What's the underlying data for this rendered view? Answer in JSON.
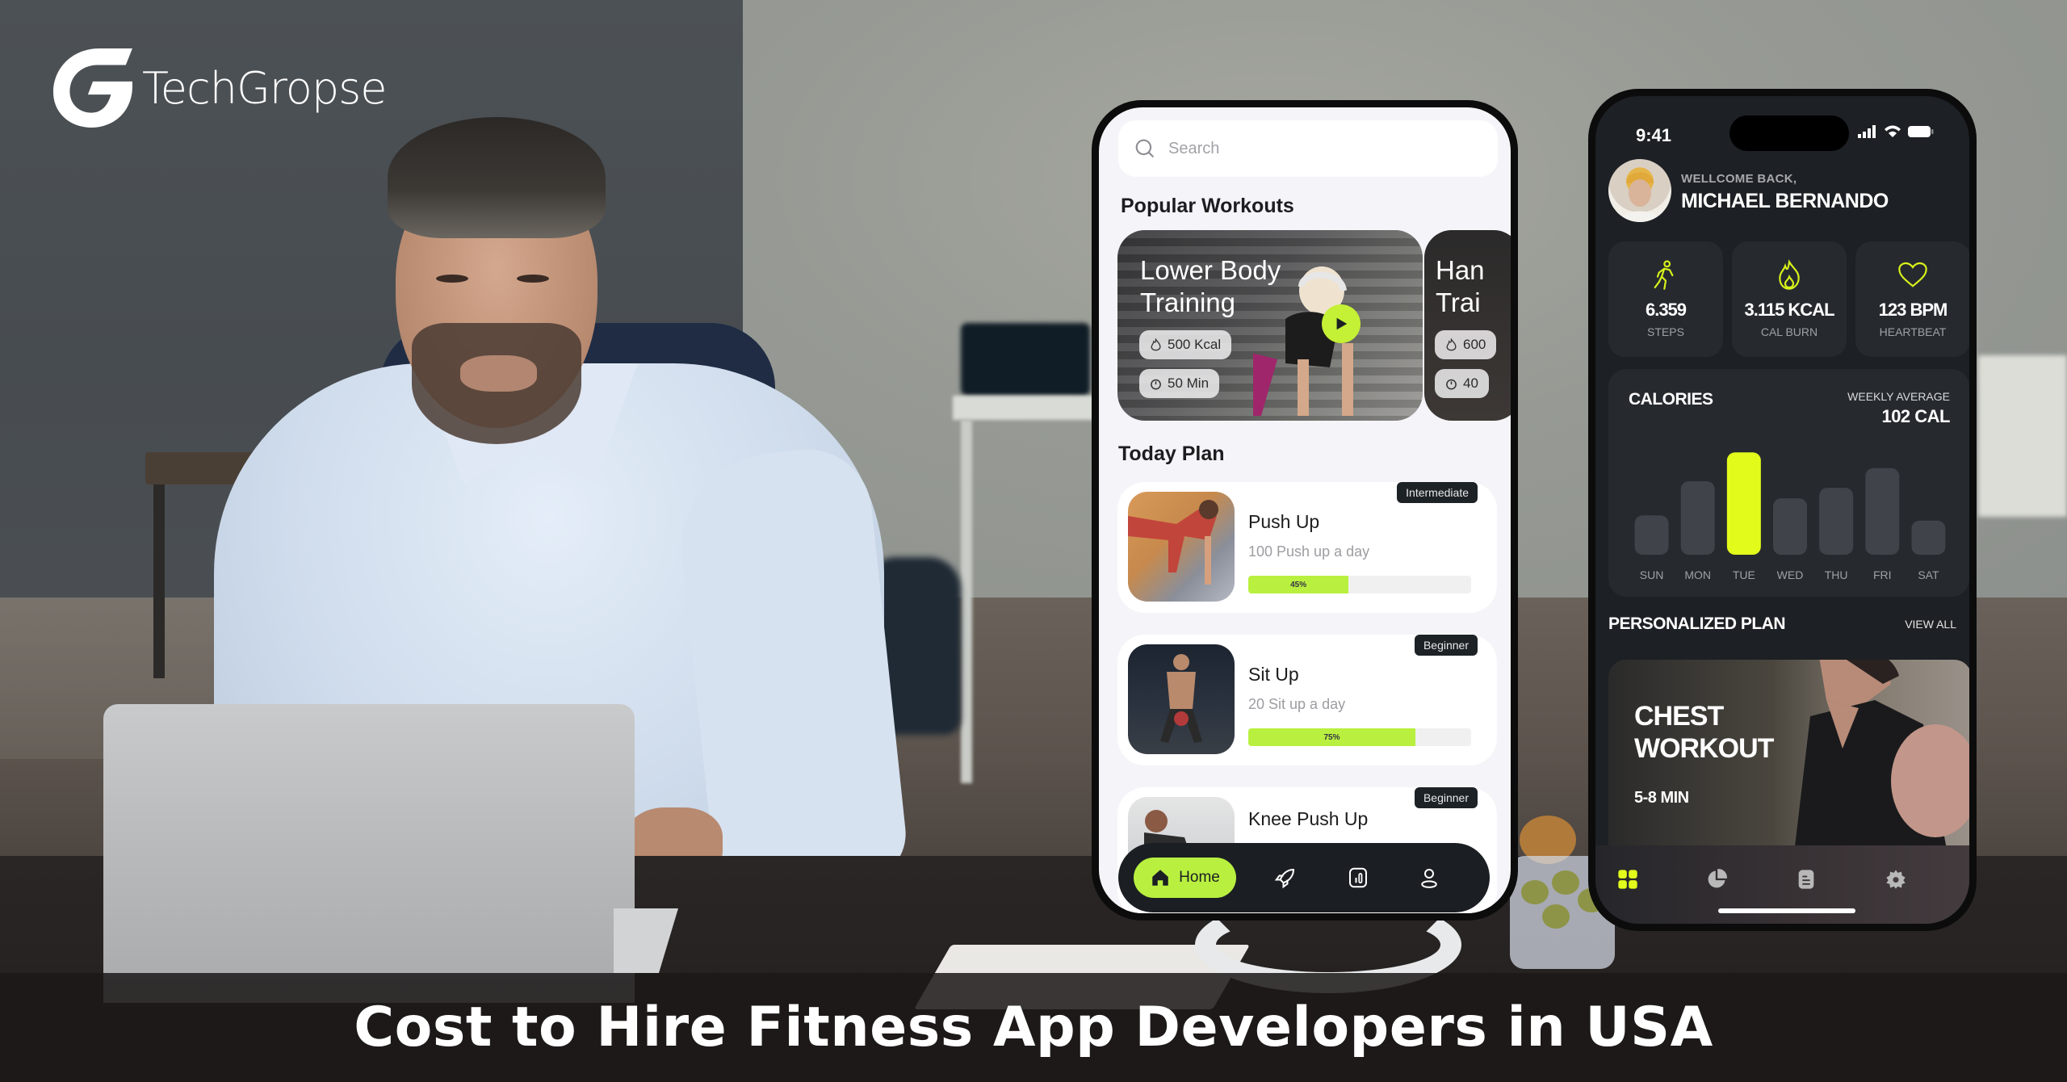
{
  "brand": {
    "name": "TechGropse",
    "logo_icon": "g-leaf-logo"
  },
  "headline": "Cost to Hire Fitness App Developers in USA",
  "left_phone": {
    "search": {
      "placeholder": "Search",
      "icon": "search-icon"
    },
    "popular_title": "Popular Workouts",
    "workouts": [
      {
        "title_line1": "Lower Body",
        "title_line2": "Training",
        "kcal": "500 Kcal",
        "duration": "50 Min"
      },
      {
        "title_line1": "Han",
        "title_line2": "Trai",
        "kcal": "600",
        "duration": "40"
      }
    ],
    "today_title": "Today Plan",
    "plans": [
      {
        "name": "Push Up",
        "sub": "100 Push up a day",
        "level": "Intermediate",
        "progress": 45,
        "progress_label": "45%"
      },
      {
        "name": "Sit Up",
        "sub": "20 Sit up a day",
        "level": "Beginner",
        "progress": 75,
        "progress_label": "75%"
      },
      {
        "name": "Knee Push Up",
        "sub": "",
        "level": "Beginner"
      }
    ],
    "nav": {
      "home_label": "Home",
      "icons": [
        "home-icon",
        "rocket-icon",
        "stats-icon",
        "profile-icon"
      ]
    },
    "accent": "#b9f040"
  },
  "right_phone": {
    "status": {
      "time": "9:41"
    },
    "welcome": "WELLCOME BACK,",
    "user_name": "MICHAEL BERNANDO",
    "stats": [
      {
        "icon": "walking-icon",
        "value": "6.359",
        "label": "STEPS"
      },
      {
        "icon": "flame-icon",
        "value": "3.115 KCAL",
        "label": "CAL BURN"
      },
      {
        "icon": "heart-icon",
        "value": "123 BPM",
        "label": "HEARTBEAT"
      }
    ],
    "calories": {
      "title": "CALORIES",
      "avg_label": "WEEKLY AVERAGE",
      "avg_value": "102 CAL"
    },
    "plan_title": "PERSONALIZED PLAN",
    "view_all": "VIEW ALL",
    "plan_card": {
      "line1": "CHEST",
      "line2": "WORKOUT",
      "duration": "5-8 MIN"
    },
    "tabs": [
      "grid-icon",
      "pie-chart-icon",
      "document-icon",
      "settings-icon"
    ],
    "accent": "#e2fb1b"
  },
  "chart_data": {
    "type": "bar",
    "title": "CALORIES",
    "categories": [
      "SUN",
      "MON",
      "TUE",
      "WED",
      "THU",
      "FRI",
      "SAT"
    ],
    "values": [
      30,
      56,
      78,
      43,
      51,
      66,
      26
    ],
    "highlight": "TUE",
    "ylim": [
      0,
      80
    ],
    "xlabel": "",
    "ylabel": "",
    "grid": false,
    "annotation": "WEEKLY AVERAGE 102 CAL"
  }
}
